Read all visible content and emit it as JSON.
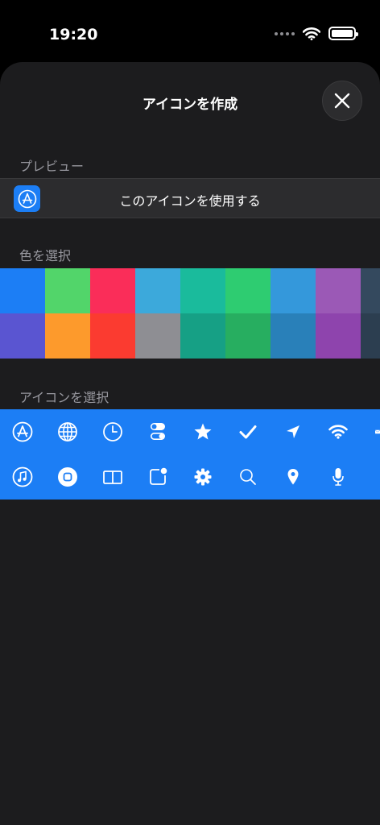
{
  "status": {
    "time": "19:20"
  },
  "sheet": {
    "title": "アイコンを作成",
    "sections": {
      "preview": "プレビュー",
      "color": "色を選択",
      "icon": "アイコンを選択"
    },
    "preview_label": "このアイコンを使用する"
  },
  "colors": {
    "selected_icon_background": "#1c7ef5",
    "row1": [
      "#1c7ef5",
      "#52d56a",
      "#fa2d59",
      "#3ca9db",
      "#1abb9c",
      "#2ecc71",
      "#3498db",
      "#9b59b6",
      "#34495e"
    ],
    "row2": [
      "#5a55d1",
      "#fd9a2c",
      "#fb3b30",
      "#8e8e93",
      "#16a085",
      "#27ae60",
      "#2980b9",
      "#8e44ad",
      "#2c3e50"
    ]
  },
  "icons": {
    "row1": [
      "app-store-icon",
      "globe-icon",
      "clock-icon",
      "toggles-icon",
      "star-icon",
      "checkmark-icon",
      "location-arrow-icon",
      "wifi-icon",
      "envelope-icon"
    ],
    "row2": [
      "music-note-icon",
      "home-button-icon",
      "book-icon",
      "badge-square-icon",
      "gear-icon",
      "magnifier-icon",
      "map-pin-icon",
      "microphone-icon"
    ]
  }
}
